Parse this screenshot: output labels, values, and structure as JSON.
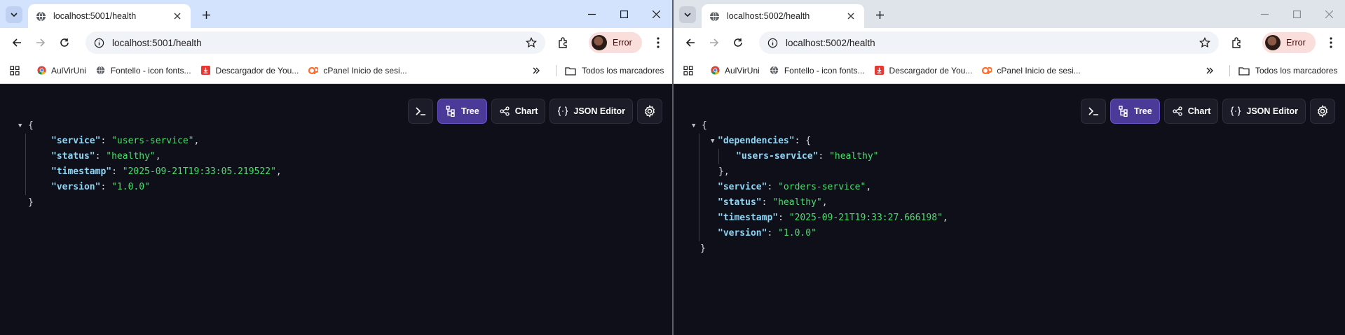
{
  "windows": [
    {
      "tab_title": "localhost:5001/health",
      "url": "localhost:5001/health",
      "profile_label": "Error",
      "bookmarks": [
        "AulVirUni",
        "Fontello - icon fonts...",
        "Descargador de You...",
        "cPanel Inicio de sesi..."
      ],
      "all_bookmarks": "Todos los marcadores",
      "viewer_buttons": {
        "terminal": "",
        "tree": "Tree",
        "chart": "Chart",
        "json_editor": "JSON Editor",
        "settings": ""
      },
      "json": {
        "open": "{",
        "close": "}",
        "fields": [
          {
            "key": "\"service\"",
            "value": "\"users-service\"",
            "comma": ","
          },
          {
            "key": "\"status\"",
            "value": "\"healthy\"",
            "comma": ","
          },
          {
            "key": "\"timestamp\"",
            "value": "\"2025-09-21T19:33:05.219522\"",
            "comma": ","
          },
          {
            "key": "\"version\"",
            "value": "\"1.0.0\"",
            "comma": ""
          }
        ]
      }
    },
    {
      "tab_title": "localhost:5002/health",
      "url": "localhost:5002/health",
      "profile_label": "Error",
      "bookmarks": [
        "AulVirUni",
        "Fontello - icon fonts...",
        "Descargador de You...",
        "cPanel Inicio de sesi..."
      ],
      "all_bookmarks": "Todos los marcadores",
      "viewer_buttons": {
        "terminal": "",
        "tree": "Tree",
        "chart": "Chart",
        "json_editor": "JSON Editor",
        "settings": ""
      },
      "json": {
        "open": "{",
        "close": "}",
        "nested_key": "\"dependencies\"",
        "nested_open": "{",
        "nested_close": "},",
        "nested_fields": [
          {
            "key": "\"users-service\"",
            "value": "\"healthy\"",
            "comma": ""
          }
        ],
        "fields": [
          {
            "key": "\"service\"",
            "value": "\"orders-service\"",
            "comma": ","
          },
          {
            "key": "\"status\"",
            "value": "\"healthy\"",
            "comma": ","
          },
          {
            "key": "\"timestamp\"",
            "value": "\"2025-09-21T19:33:27.666198\"",
            "comma": ","
          },
          {
            "key": "\"version\"",
            "value": "\"1.0.0\"",
            "comma": ""
          }
        ]
      }
    }
  ],
  "colors": {
    "key": "#8fd6f5",
    "string": "#4ade6b",
    "viewer_bg": "#0f0f1a",
    "active_button": "#4c3a99"
  },
  "icons": [
    "tab-search-icon",
    "globe-favicon-icon",
    "close-icon",
    "plus-icon",
    "minimize-icon",
    "maximize-icon",
    "back-icon",
    "forward-icon",
    "reload-icon",
    "site-info-icon",
    "star-icon",
    "extensions-icon",
    "kebab-menu-icon",
    "apps-grid-icon",
    "folder-icon",
    "chevron-double-right-icon",
    "terminal-icon",
    "tree-icon",
    "chart-icon",
    "braces-icon",
    "gear-icon"
  ]
}
